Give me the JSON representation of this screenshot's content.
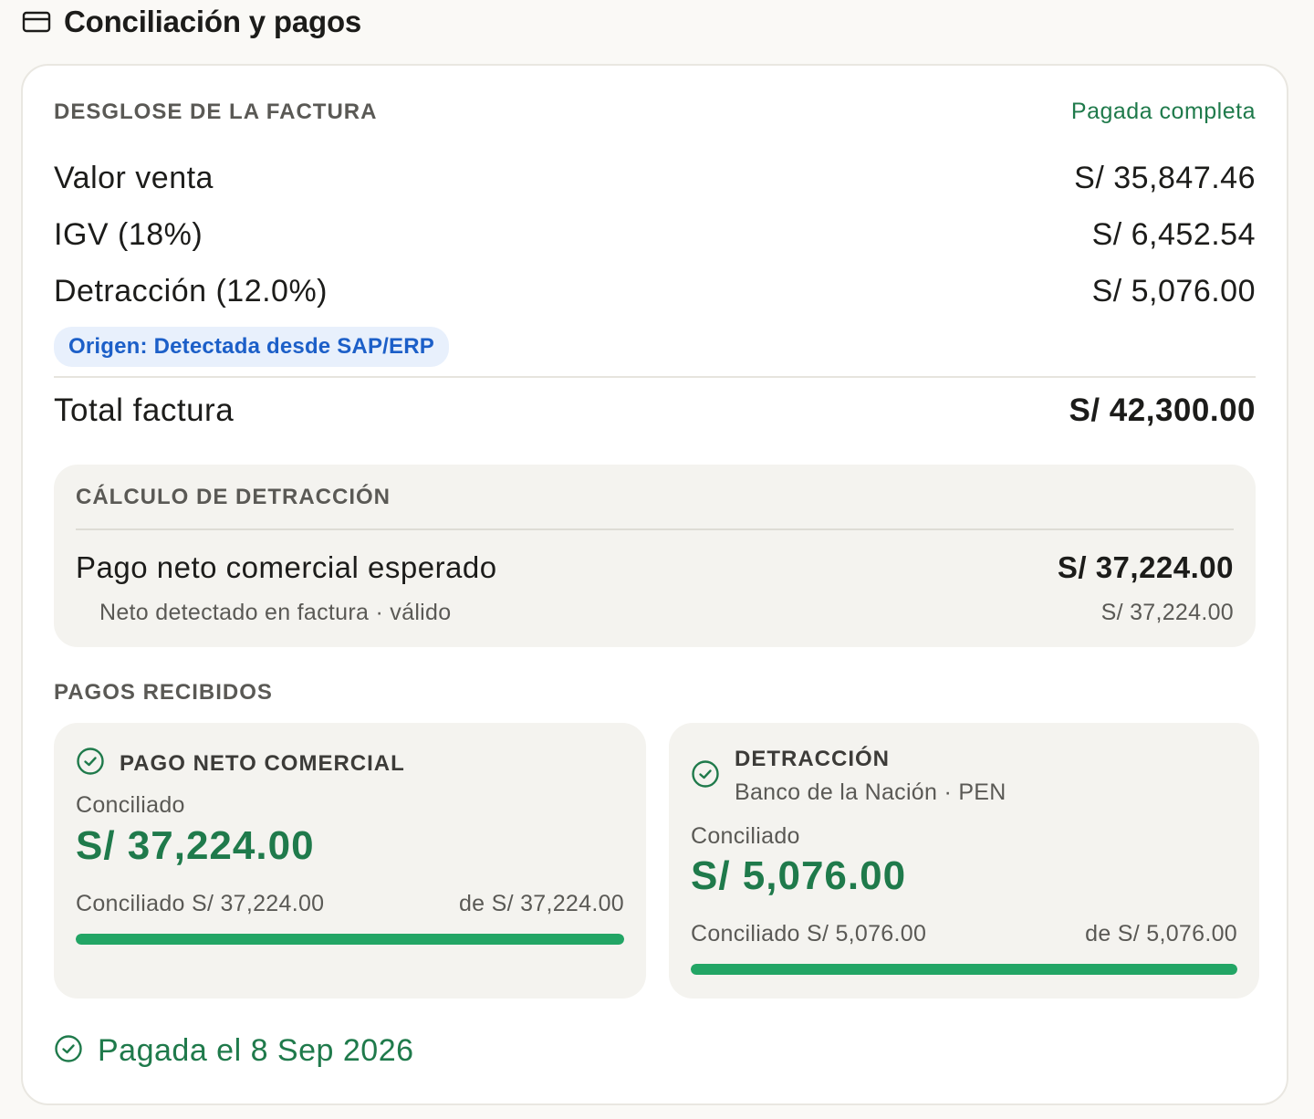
{
  "header": {
    "icon": "card-icon",
    "title": "Conciliación y pagos"
  },
  "breakdown": {
    "label": "DESGLOSE DE LA FACTURA",
    "status": "Pagada completa",
    "rows": [
      {
        "label": "Valor venta",
        "value": "S/ 35,847.46"
      },
      {
        "label": "IGV (18%)",
        "value": "S/ 6,452.54"
      },
      {
        "label": "Detracción (12.0%)",
        "value": "S/ 5,076.00"
      }
    ],
    "origin_badge": "Origen: Detectada desde SAP/ERP",
    "total_label": "Total factura",
    "total_value": "S/ 42,300.00"
  },
  "calc": {
    "label": "CÁLCULO DE DETRACCIÓN",
    "row_label": "Pago neto comercial esperado",
    "row_value": "S/ 37,224.00",
    "sub_label": "Neto detectado en factura · válido",
    "sub_value": "S/ 37,224.00"
  },
  "payments": {
    "label": "PAGOS RECIBIDOS",
    "cards": [
      {
        "title": "PAGO NETO COMERCIAL",
        "bank": "",
        "state": "Conciliado",
        "amount": "S/ 37,224.00",
        "meta_left": "Conciliado S/ 37,224.00",
        "meta_right": "de S/ 37,224.00",
        "progress": 1.0
      },
      {
        "title": "DETRACCIÓN",
        "bank": "Banco de la Nación · PEN",
        "state": "Conciliado",
        "amount": "S/ 5,076.00",
        "meta_left": "Conciliado S/ 5,076.00",
        "meta_right": "de S/ 5,076.00",
        "progress": 1.0
      }
    ]
  },
  "footer": {
    "text": "Pagada el 8 Sep 2026"
  },
  "colors": {
    "accent_green": "#1f7a4b",
    "progress_green": "#22a565",
    "badge_blue": "#1c5fc8",
    "badge_bg": "#e8f0fc"
  }
}
